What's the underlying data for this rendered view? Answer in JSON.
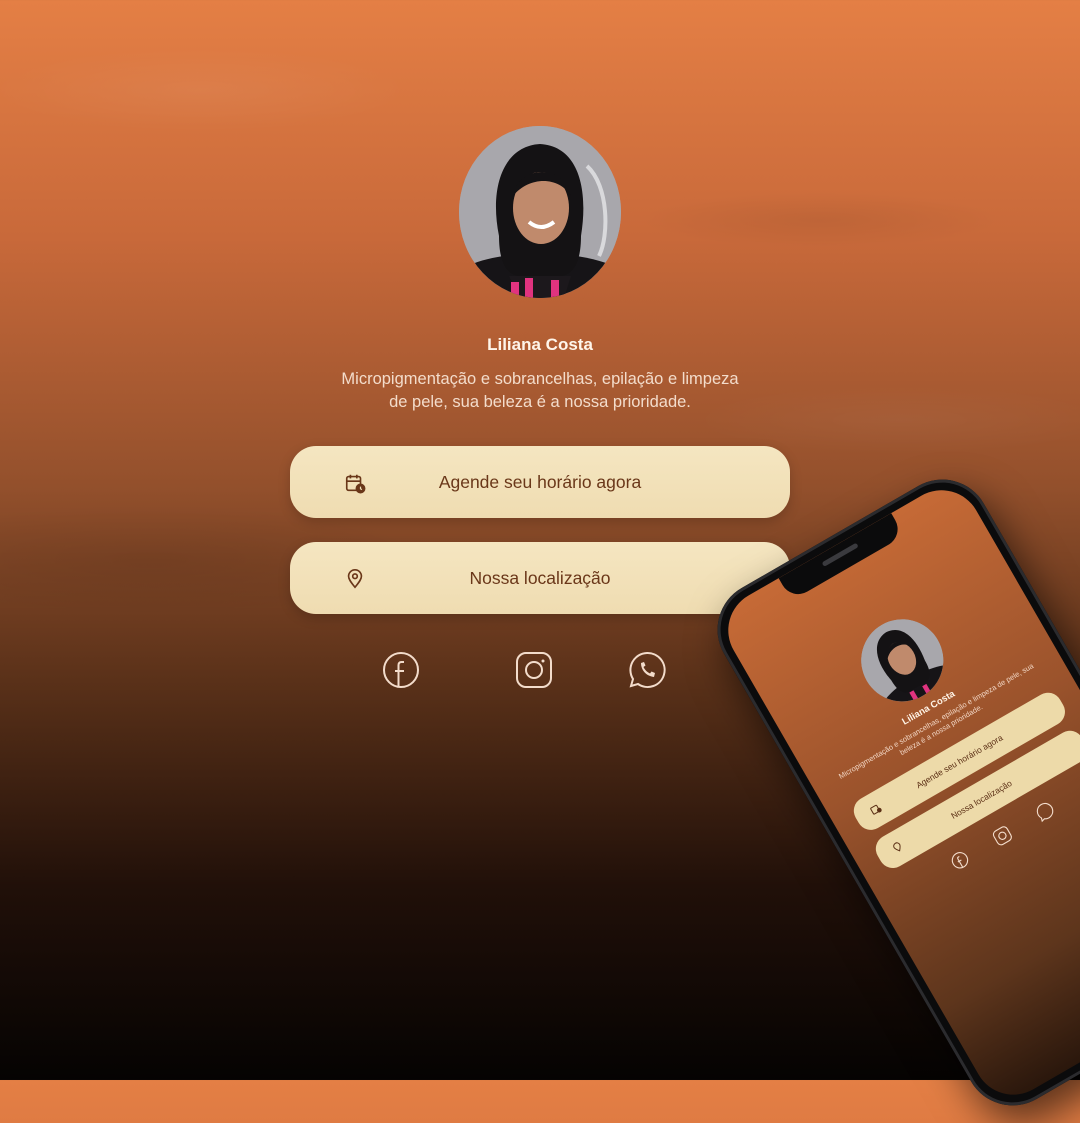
{
  "profile": {
    "name": "Liliana Costa",
    "bio": "Micropigmentação e sobrancelhas, epilação e limpeza de pele, sua beleza é a nossa prioridade."
  },
  "buttons": {
    "schedule_label": "Agende seu horário agora",
    "location_label": "Nossa localização"
  },
  "icons": {
    "schedule": "calendar-clock-icon",
    "location": "map-pin-icon",
    "facebook": "facebook-icon",
    "instagram": "instagram-icon",
    "whatsapp": "whatsapp-icon"
  },
  "colors": {
    "button_bg": "#f3e3bc",
    "button_text": "#6a3719",
    "accent": "#e47f45"
  }
}
